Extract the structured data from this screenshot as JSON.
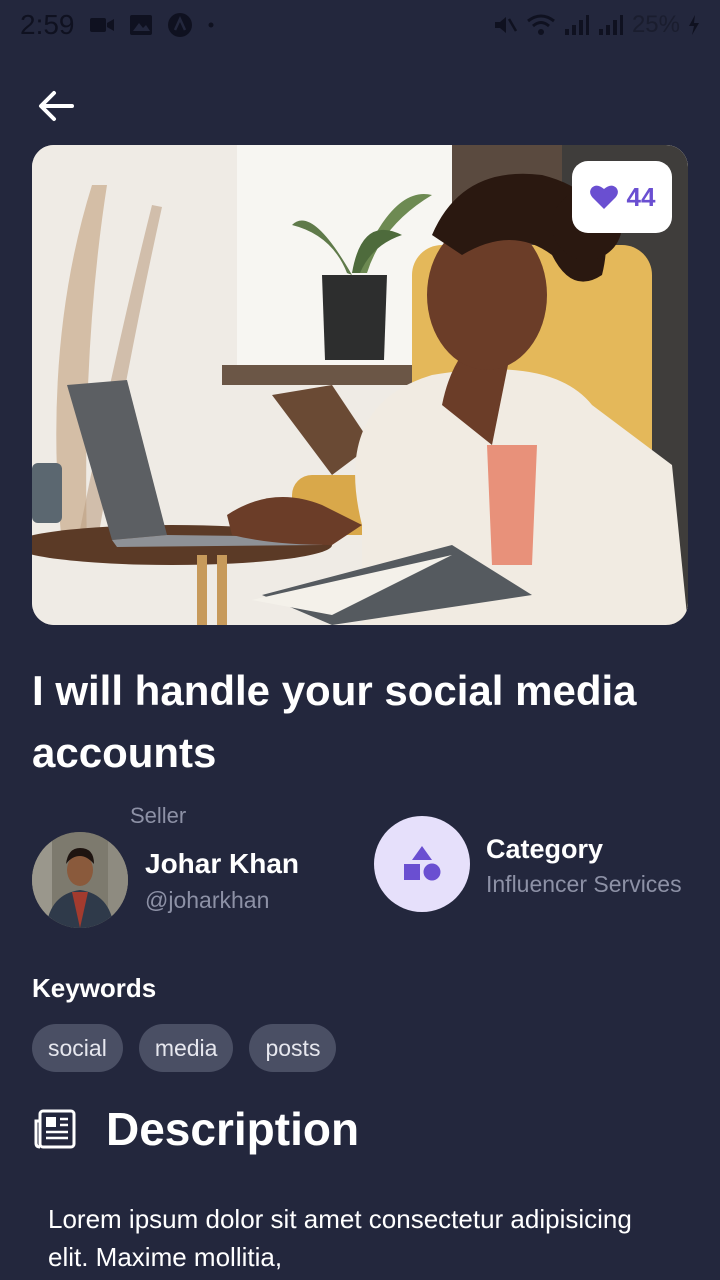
{
  "status_bar": {
    "time": "2:59",
    "battery": "25%"
  },
  "gig": {
    "likes": "44",
    "title": "I will handle your social media accounts"
  },
  "seller": {
    "label": "Seller",
    "name": "Johar Khan",
    "handle": "@joharkhan"
  },
  "category": {
    "label": "Category",
    "value": "Influencer Services"
  },
  "keywords": {
    "label": "Keywords",
    "items": [
      "social",
      "media",
      "posts"
    ]
  },
  "description": {
    "title": "Description",
    "text": "Lorem ipsum dolor sit amet consectetur adipisicing elit. Maxime mollitia,"
  },
  "colors": {
    "background": "#23273d",
    "accent": "#6a4fd1",
    "chip": "#4a4f64",
    "muted_text": "#8d91a6",
    "category_circle": "#e6e0fb"
  },
  "icons": {
    "back": "arrow-left-icon",
    "like": "heart-icon",
    "category": "shapes-icon",
    "description": "newspaper-icon"
  }
}
